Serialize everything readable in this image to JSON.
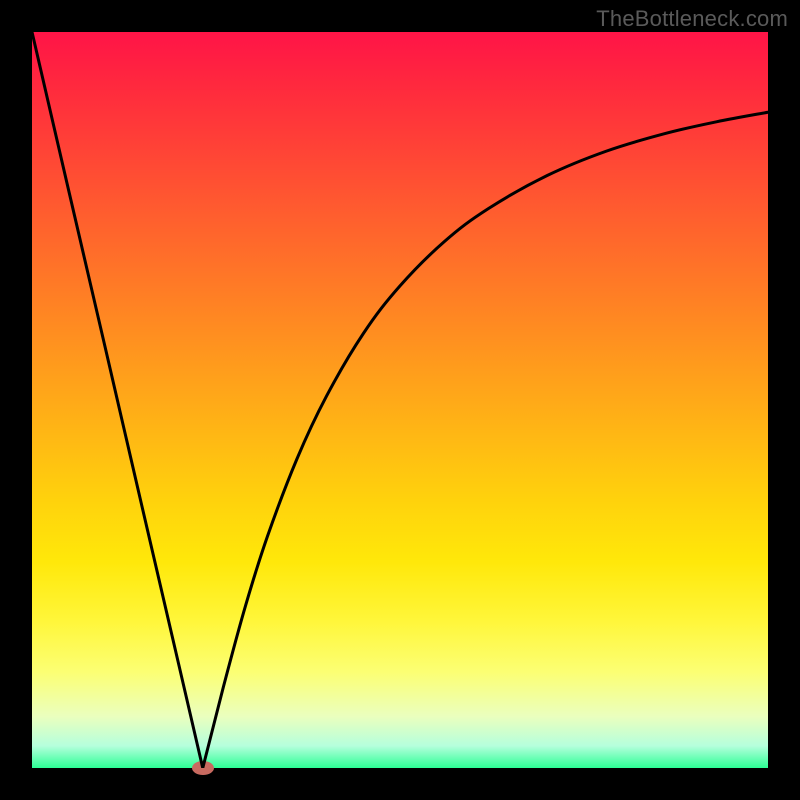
{
  "watermark": "TheBottleneck.com",
  "chart_data": {
    "type": "line",
    "title": "",
    "xlabel": "",
    "ylabel": "",
    "xlim": [
      0,
      1
    ],
    "ylim": [
      0,
      1
    ],
    "series": [
      {
        "name": "left-branch",
        "x": [
          0.0,
          0.05,
          0.1,
          0.15,
          0.2,
          0.232
        ],
        "values": [
          1.0,
          0.784,
          0.569,
          0.353,
          0.138,
          0.0
        ]
      },
      {
        "name": "right-branch",
        "x": [
          0.232,
          0.26,
          0.29,
          0.32,
          0.36,
          0.4,
          0.45,
          0.5,
          0.56,
          0.62,
          0.7,
          0.78,
          0.86,
          0.93,
          1.0
        ],
        "values": [
          0.0,
          0.11,
          0.22,
          0.315,
          0.42,
          0.505,
          0.59,
          0.655,
          0.715,
          0.76,
          0.805,
          0.838,
          0.862,
          0.878,
          0.891
        ]
      }
    ],
    "annotations": [
      {
        "name": "minimum-marker",
        "x": 0.232,
        "y": 0.0
      }
    ]
  },
  "colors": {
    "curve": "#000000",
    "dot": "#c86a60",
    "frame": "#000000"
  }
}
